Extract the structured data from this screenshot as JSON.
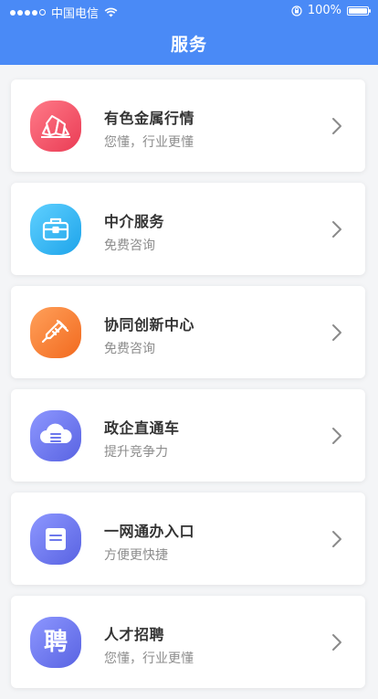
{
  "status_bar": {
    "carrier": "中国电信",
    "battery": "100%"
  },
  "header": {
    "title": "服务"
  },
  "colors": {
    "header_bg": "#4a8af6"
  },
  "services": [
    {
      "title": "有色金属行情",
      "subtitle": "您懂，行业更懂",
      "icon": "crystal-icon",
      "color": "#f2566a"
    },
    {
      "title": "中介服务",
      "subtitle": "免费咨询",
      "icon": "briefcase-icon",
      "color": "#34b3f2"
    },
    {
      "title": "协同创新中心",
      "subtitle": "免费咨询",
      "icon": "syringe-icon",
      "color": "#f7843a"
    },
    {
      "title": "政企直通车",
      "subtitle": "提升竞争力",
      "icon": "cloud-icon",
      "color": "#6d78ec"
    },
    {
      "title": "一网通办入口",
      "subtitle": "方便更快捷",
      "icon": "document-icon",
      "color": "#6d78ec"
    },
    {
      "title": "人才招聘",
      "subtitle": "您懂，行业更懂",
      "icon": "recruit-icon",
      "icon_text": "聘",
      "color": "#6d78ec"
    }
  ]
}
